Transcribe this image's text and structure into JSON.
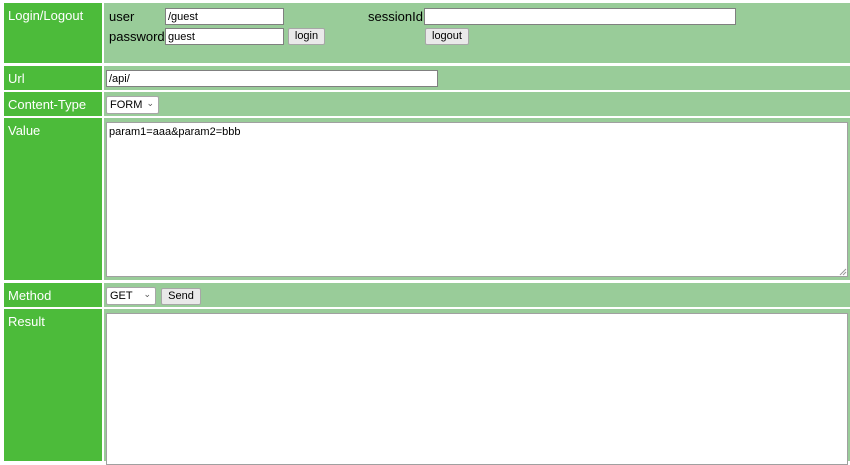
{
  "login": {
    "row_label": "Login/Logout",
    "user_label": "user",
    "user_value": "/guest",
    "password_label": "password",
    "password_value": "guest",
    "login_button": "login",
    "session_label": "sessionId",
    "session_value": "",
    "logout_button": "logout"
  },
  "url": {
    "row_label": "Url",
    "value": "/api/"
  },
  "content_type": {
    "row_label": "Content-Type",
    "selected": "FORM"
  },
  "value": {
    "row_label": "Value",
    "text": "param1=aaa&param2=bbb"
  },
  "method": {
    "row_label": "Method",
    "selected": "GET",
    "send_button": "Send"
  },
  "result": {
    "row_label": "Result",
    "text": ""
  },
  "icons": {
    "dropdown": "chevron-down-icon",
    "resize": "resize-grip-icon"
  },
  "colors": {
    "label_bg": "#4cbb3a",
    "cell_bg": "#99cc99",
    "label_text": "#ffffff"
  }
}
